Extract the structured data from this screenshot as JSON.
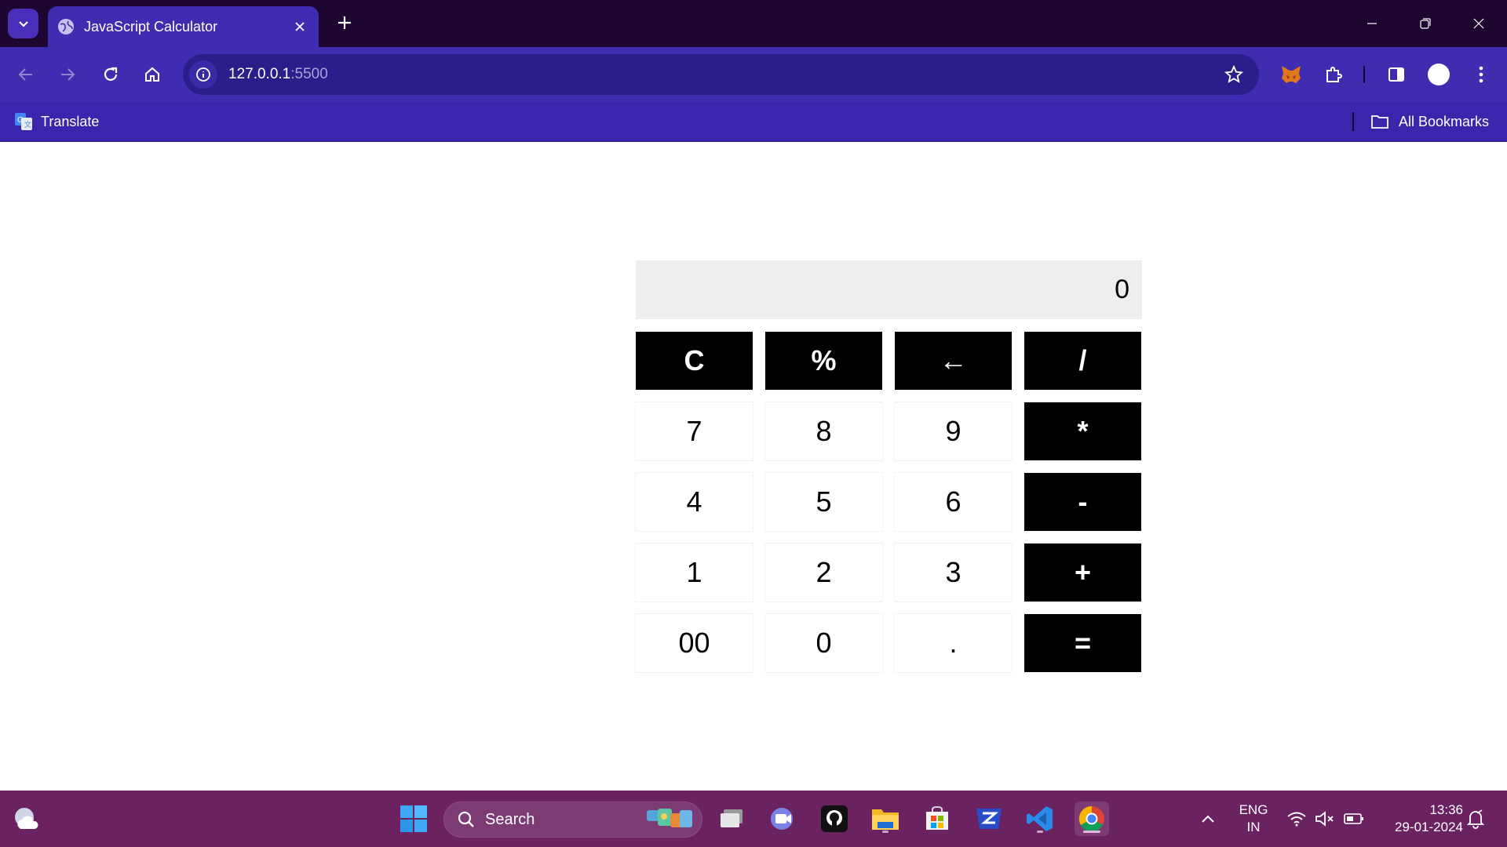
{
  "browser": {
    "tab": {
      "title": "JavaScript Calculator"
    },
    "url": {
      "host": "127.0.0.1",
      "port": ":5500"
    },
    "bookmarks": {
      "translate": "Translate",
      "all_bookmarks": "All Bookmarks"
    },
    "colors": {
      "tabbar": "#1e0631",
      "toolbar": "#3f2cb0",
      "omnibox": "#2b1d8a"
    }
  },
  "calculator": {
    "display_value": "0",
    "keys": [
      [
        "C",
        "%",
        "←",
        "/"
      ],
      [
        "7",
        "8",
        "9",
        "*"
      ],
      [
        "4",
        "5",
        "6",
        "-"
      ],
      [
        "1",
        "2",
        "3",
        "+"
      ],
      [
        "00",
        "0",
        ".",
        "="
      ]
    ]
  },
  "taskbar": {
    "search_label": "Search",
    "language": {
      "line1": "ENG",
      "line2": "IN"
    },
    "time": "13:36",
    "date": "29-01-2024",
    "colors": {
      "background": "#6a2260"
    }
  }
}
